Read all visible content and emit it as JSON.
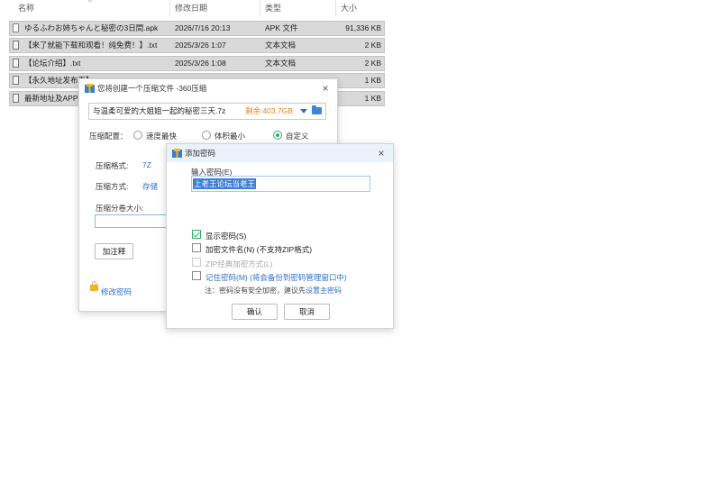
{
  "explorer": {
    "columns": {
      "name": "名称",
      "modified": "修改日期",
      "type": "类型",
      "size": "大小"
    },
    "rows": [
      {
        "name": "ゆるふわお姉ちゃんと秘密の3日間.apk",
        "modified": "2026/7/16 20:13",
        "type": "APK 文件",
        "size": "91,336 KB"
      },
      {
        "name": "【来了就能下载和观看！纯免费！】.txt",
        "modified": "2025/3/26 1:07",
        "type": "文本文档",
        "size": "2 KB"
      },
      {
        "name": "【论坛介绍】.txt",
        "modified": "2025/3/26 1:08",
        "type": "文本文档",
        "size": "2 KB"
      },
      {
        "name": "【永久地址发布页】",
        "modified": "",
        "type": "",
        "size": "1 KB"
      },
      {
        "name": "最新地址及APP",
        "modified": "",
        "type": "",
        "size": "1 KB"
      }
    ]
  },
  "compress_dialog": {
    "title": "您将创建一个压缩文件 -360压缩",
    "close": "×",
    "path": "与温柔可爱的大姐姐一起的秘密三天.7z",
    "free_space": "剩余:403.7GB",
    "config_label": "压缩配置：",
    "options": [
      "速度最快",
      "体积最小",
      "自定义"
    ],
    "selected_option": "自定义",
    "format_label": "压缩格式:",
    "format_value": "7Z",
    "method_label": "压缩方式:",
    "method_value": "存储",
    "split_label": "压缩分卷大小:",
    "comment_button": "加注释",
    "modify_password": "修改密码"
  },
  "password_dialog": {
    "title": "添加密码",
    "close": "×",
    "input_label": "输入密码(E)",
    "password_value": "上老王论坛当老王",
    "checkboxes": [
      {
        "label": "显示密码(S)",
        "checked": true,
        "disabled": false
      },
      {
        "label": "加密文件名(N) (不支持ZIP格式)",
        "checked": false,
        "disabled": false
      },
      {
        "label": "ZIP经典加密方式(L)",
        "checked": false,
        "disabled": true
      },
      {
        "label": "记住密码(M) (将会备份到密码管理窗口中)",
        "checked": false,
        "disabled": false
      }
    ],
    "note_prefix": "注：密码没有安全加密，建议先",
    "note_link": "设置主密码",
    "ok": "确认",
    "cancel": "取消"
  },
  "colors": {
    "accent_blue": "#2d6fc9",
    "accent_green": "#2fae6b",
    "free_space_orange": "#e87d1e"
  }
}
